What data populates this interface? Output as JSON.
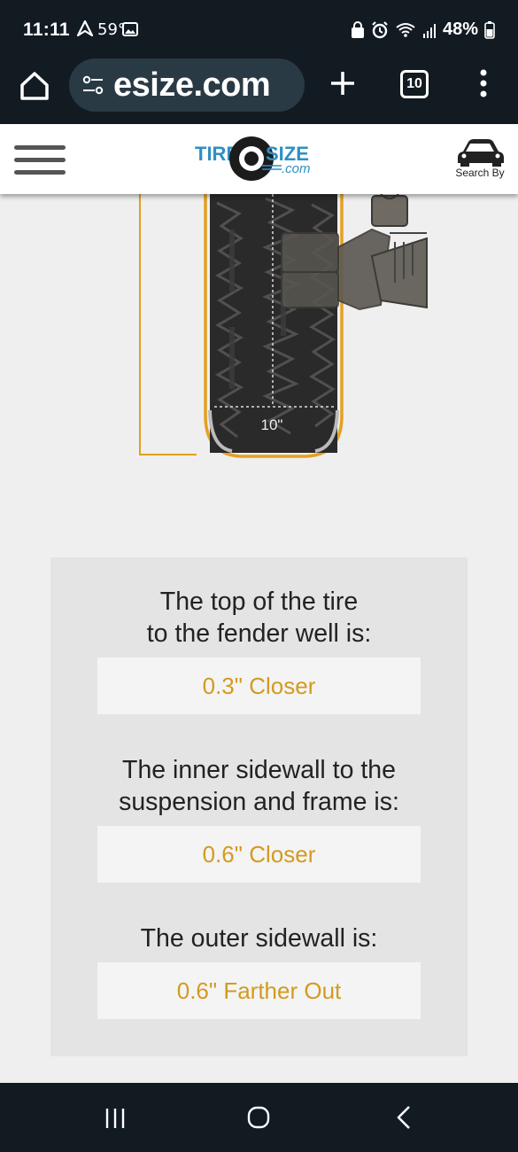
{
  "status_bar": {
    "time": "11:11",
    "temperature": "59°",
    "battery": "48%"
  },
  "browser": {
    "url": "esize.com",
    "tab_count": "10"
  },
  "site": {
    "logo_text_left": "TIRE",
    "logo_text_right": "SIZE",
    "logo_text_domain": ".com",
    "search_by_label": "Search By"
  },
  "diagram": {
    "width_label": "10\""
  },
  "results": [
    {
      "heading_line1": "The top of the tire",
      "heading_line2": "to the fender well is:",
      "value": "0.3\" Closer"
    },
    {
      "heading_line1": "The inner sidewall to the",
      "heading_line2": "suspension and frame is:",
      "value": "0.6\" Closer"
    },
    {
      "heading_line1": "The outer sidewall is:",
      "heading_line2": "",
      "value": "0.6\" Farther Out"
    }
  ],
  "colors": {
    "accent": "#d49a1e",
    "dark_chrome": "#121a22",
    "logo_blue": "#2f8fc4"
  }
}
